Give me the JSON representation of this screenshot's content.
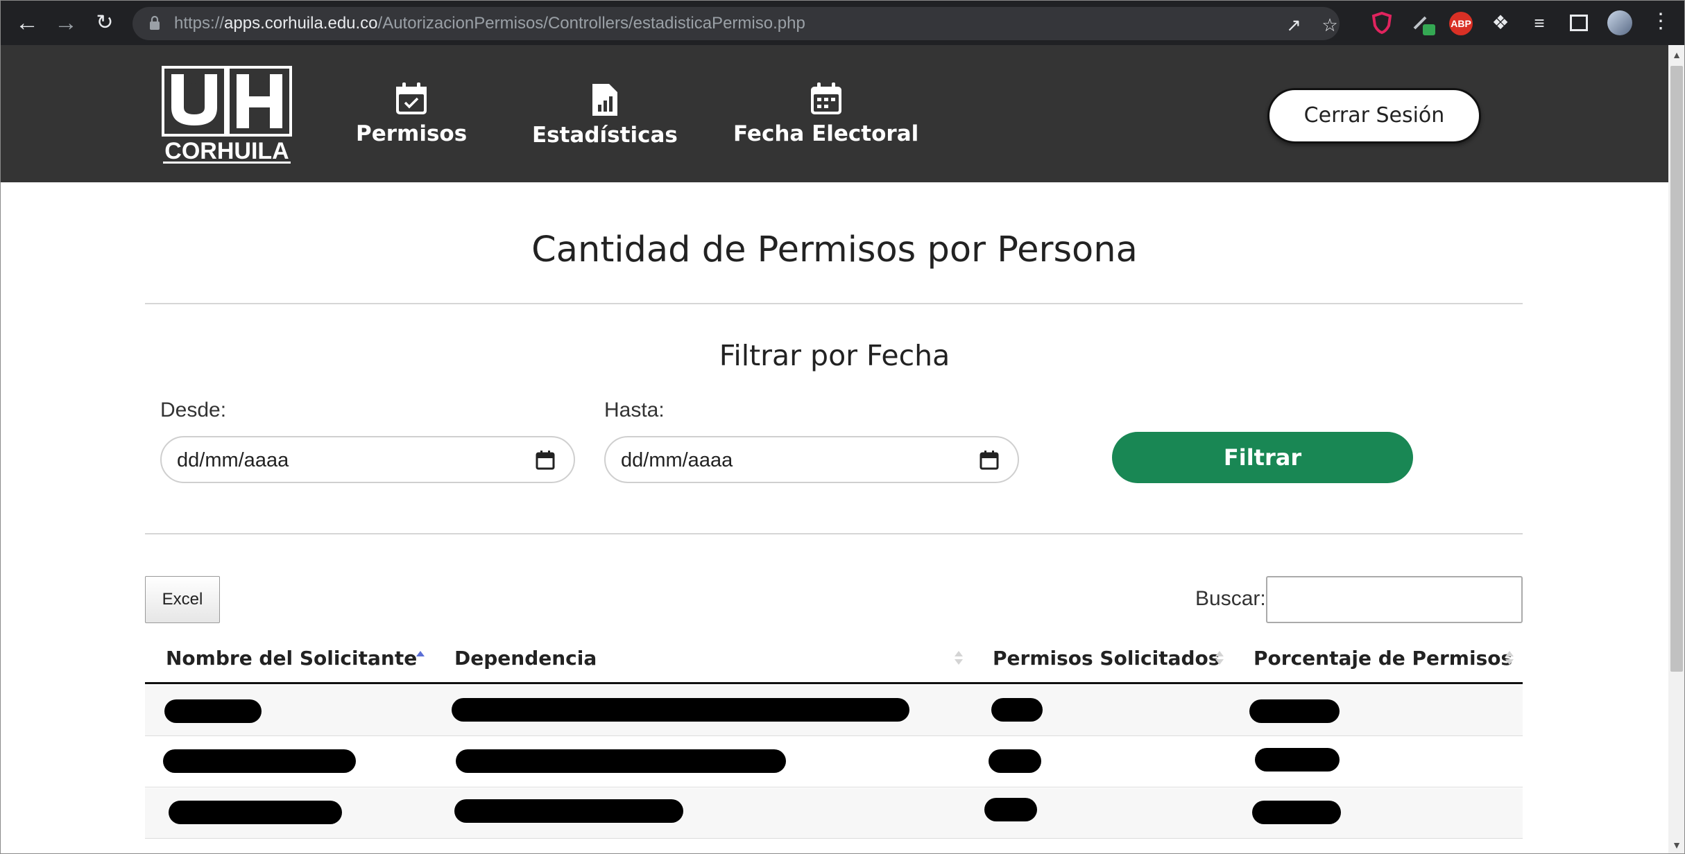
{
  "browser": {
    "url_scheme": "https://",
    "url_host": "apps.corhuila.edu.co",
    "url_path": "/AutorizacionPermisos/Controllers/estadisticaPermiso.php",
    "abp_label": "ABP"
  },
  "header": {
    "logo_text": "CORHUILA",
    "nav": [
      {
        "label": "Permisos",
        "icon": "calendar-check-icon"
      },
      {
        "label": "Estadísticas",
        "icon": "file-chart-icon"
      },
      {
        "label": "Fecha Electoral",
        "icon": "calendar-event-icon"
      }
    ],
    "logout_label": "Cerrar Sesión"
  },
  "main": {
    "title": "Cantidad de Permisos por Persona",
    "filter_title": "Filtrar por Fecha",
    "from_label": "Desde:",
    "from_placeholder": "dd/mm/aaaa",
    "to_label": "Hasta:",
    "to_placeholder": "dd/mm/aaaa",
    "filter_button": "Filtrar",
    "excel_button": "Excel",
    "search_label": "Buscar:",
    "search_value": ""
  },
  "table": {
    "columns": [
      "Nombre del Solicitante",
      "Dependencia",
      "Permisos Solicitados",
      "Porcentaje de Permisos"
    ],
    "sorted_column": "Nombre del Solicitante",
    "sort_direction": "ascending",
    "rows_redacted": 3
  },
  "colors": {
    "header_bg": "#343434",
    "filter_button": "#198754",
    "browser_bar": "#202124"
  }
}
